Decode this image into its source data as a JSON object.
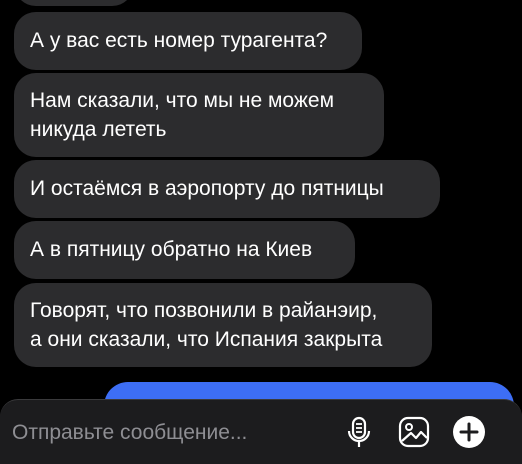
{
  "messages": [
    {
      "text": "А у вас есть номер турагента?"
    },
    {
      "line1": "Нам сказали, что мы не можем",
      "line2": "никуда лететь"
    },
    {
      "text": "И остаёмся в аэропорту до пятницы"
    },
    {
      "text": "А в пятницу обратно на Киев"
    },
    {
      "line1": "Говорят, что позвонили в райанэир,",
      "line2": "а они сказали, что Испания закрыта"
    }
  ],
  "composer": {
    "placeholder": "Отправьте сообщение...",
    "icons": [
      "microphone-icon",
      "image-icon",
      "plus-icon"
    ]
  },
  "colors": {
    "background": "#000000",
    "incoming_bubble": "#2c2c2e",
    "outgoing_bubble": "#3d6ef5",
    "composer": "#1c1c1e"
  }
}
